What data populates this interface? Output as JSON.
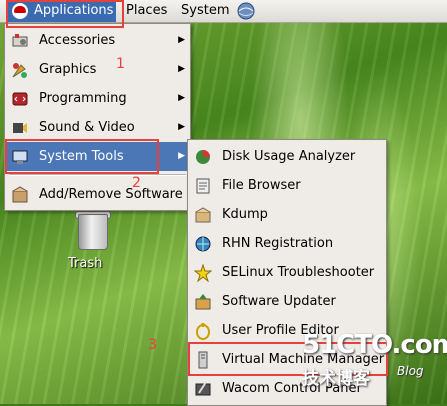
{
  "panel": {
    "applications": "Applications",
    "places": "Places",
    "system": "System"
  },
  "menu": {
    "items": [
      {
        "label": "Accessories",
        "icon": "accessories-icon"
      },
      {
        "label": "Graphics",
        "icon": "graphics-icon"
      },
      {
        "label": "Programming",
        "icon": "programming-icon"
      },
      {
        "label": "Sound & Video",
        "icon": "sound-video-icon"
      },
      {
        "label": "System Tools",
        "icon": "system-tools-icon"
      },
      {
        "label": "Add/Remove Software",
        "icon": "add-remove-software-icon"
      }
    ]
  },
  "submenu": {
    "items": [
      {
        "label": "Disk Usage Analyzer",
        "icon": "disk-usage-icon"
      },
      {
        "label": "File Browser",
        "icon": "file-browser-icon"
      },
      {
        "label": "Kdump",
        "icon": "kdump-icon"
      },
      {
        "label": "RHN Registration",
        "icon": "rhn-icon"
      },
      {
        "label": "SELinux Troubleshooter",
        "icon": "selinux-star-icon"
      },
      {
        "label": "Software Updater",
        "icon": "software-updater-icon"
      },
      {
        "label": "User Profile Editor",
        "icon": "user-profile-icon"
      },
      {
        "label": "Virtual Machine Manager",
        "icon": "virtual-machine-icon"
      },
      {
        "label": "Wacom Control Panel",
        "icon": "wacom-icon"
      }
    ]
  },
  "desktop": {
    "trash_label": "Trash"
  },
  "annotations": {
    "one": "1",
    "two": "2",
    "three": "3"
  },
  "watermark": {
    "site": "51CTO.com",
    "cn": "技术博客",
    "blog": "Blog"
  },
  "colors": {
    "highlight": "#4b77b6",
    "annotation": "#e8413b"
  }
}
